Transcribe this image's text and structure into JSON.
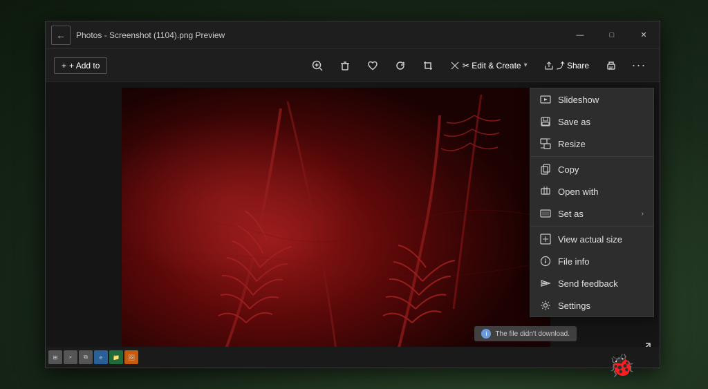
{
  "window": {
    "title": "Photos - Screenshot (1104).png Preview"
  },
  "titlebar": {
    "back_label": "←",
    "minimize_label": "—",
    "maximize_label": "□",
    "close_label": "✕"
  },
  "toolbar": {
    "add_to_label": "+ Add to",
    "zoom_in_label": "⊕",
    "delete_label": "🗑",
    "heart_label": "♡",
    "rotate_label": "↺",
    "crop_label": "⊡",
    "edit_create_label": "✂ Edit & Create",
    "share_label": "⤴ Share",
    "print_label": "🖨",
    "more_label": "···"
  },
  "menu": {
    "items": [
      {
        "id": "slideshow",
        "icon": "slideshow",
        "label": "Slideshow",
        "has_chevron": false
      },
      {
        "id": "save-as",
        "icon": "save-as",
        "label": "Save as",
        "has_chevron": false
      },
      {
        "id": "resize",
        "icon": "resize",
        "label": "Resize",
        "has_chevron": false
      },
      {
        "id": "copy",
        "icon": "copy",
        "label": "Copy",
        "has_chevron": false
      },
      {
        "id": "open-with",
        "icon": "open-with",
        "label": "Open with",
        "has_chevron": false
      },
      {
        "id": "set-as",
        "icon": "set-as",
        "label": "Set as",
        "has_chevron": true
      },
      {
        "id": "view-actual-size",
        "icon": "view-actual-size",
        "label": "View actual size",
        "has_chevron": false
      },
      {
        "id": "file-info",
        "icon": "file-info",
        "label": "File info",
        "has_chevron": false
      },
      {
        "id": "send-feedback",
        "icon": "send-feedback",
        "label": "Send feedback",
        "has_chevron": false
      },
      {
        "id": "settings",
        "icon": "settings",
        "label": "Settings",
        "has_chevron": false
      }
    ]
  },
  "toast": {
    "text": "The file didn't download."
  },
  "colors": {
    "window_bg": "#1e1e1e",
    "menu_bg": "#2d2d2d",
    "accent": "#0078d4"
  }
}
